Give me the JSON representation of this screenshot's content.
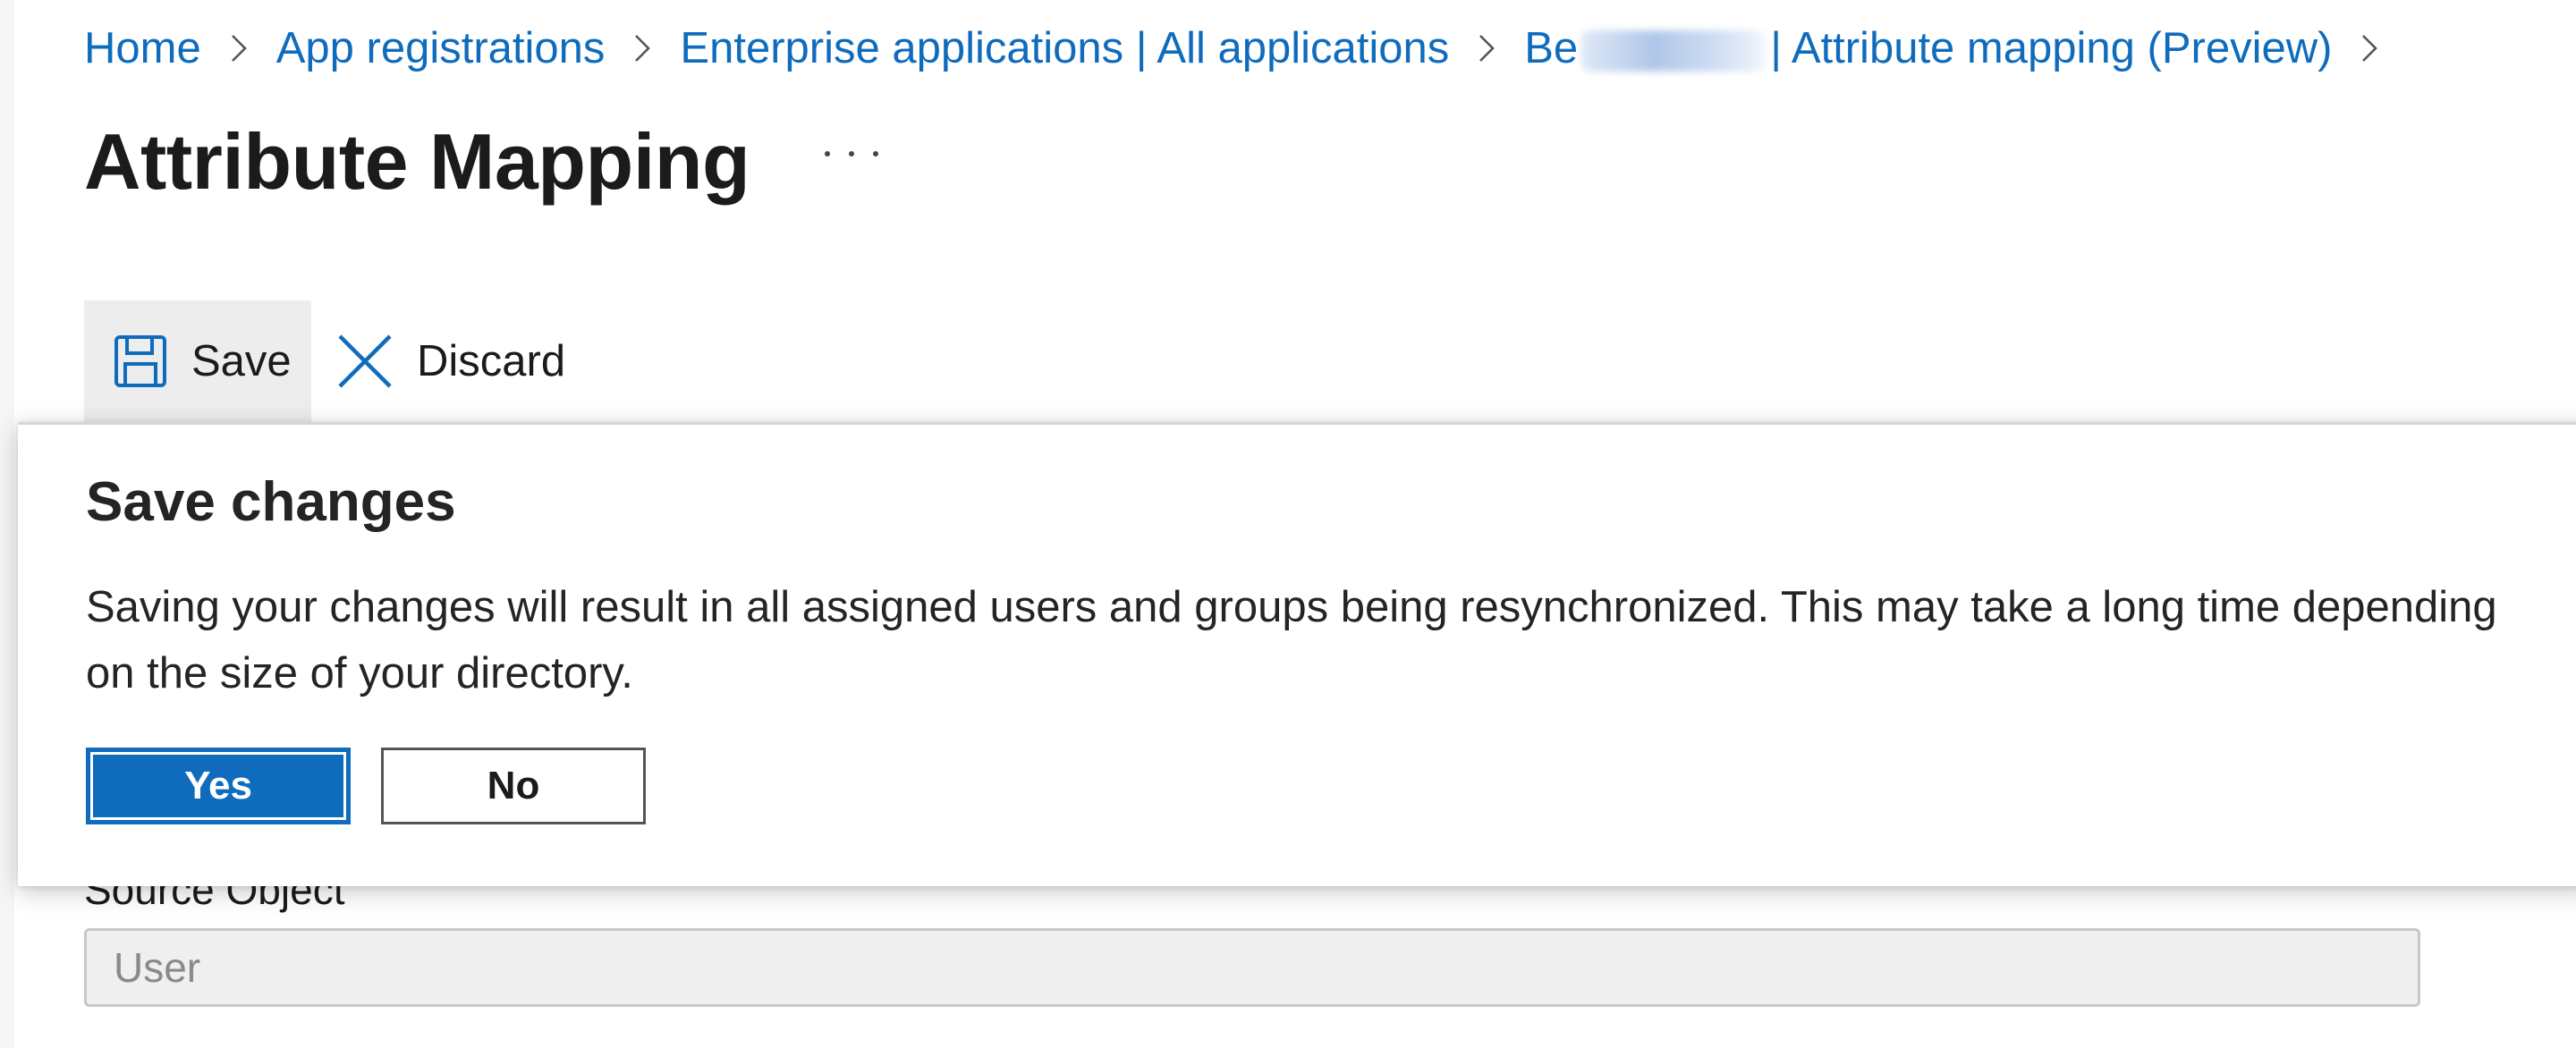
{
  "breadcrumb": {
    "items": [
      "Home",
      "App registrations",
      "Enterprise applications | All applications",
      "Be"
    ],
    "last_suffix": "| Attribute mapping (Preview)"
  },
  "page": {
    "title": "Attribute Mapping"
  },
  "toolbar": {
    "save_label": "Save",
    "discard_label": "Discard"
  },
  "dialog": {
    "title": "Save changes",
    "message": "Saving your changes will result in all assigned users and groups being resynchronized. This may take a long time depending on the size of your directory.",
    "yes_label": "Yes",
    "no_label": "No"
  },
  "form": {
    "source_object_label": "Source Object",
    "source_object_value": "User"
  },
  "colors": {
    "accent": "#0f6cbd",
    "link": "#0f6cbd",
    "text": "#1b1b1b",
    "toolbar_active_bg": "#ededed"
  },
  "icons": {
    "save": "save-icon",
    "discard": "close-icon",
    "more": "more-options-icon",
    "separator": "chevron-right-icon"
  }
}
